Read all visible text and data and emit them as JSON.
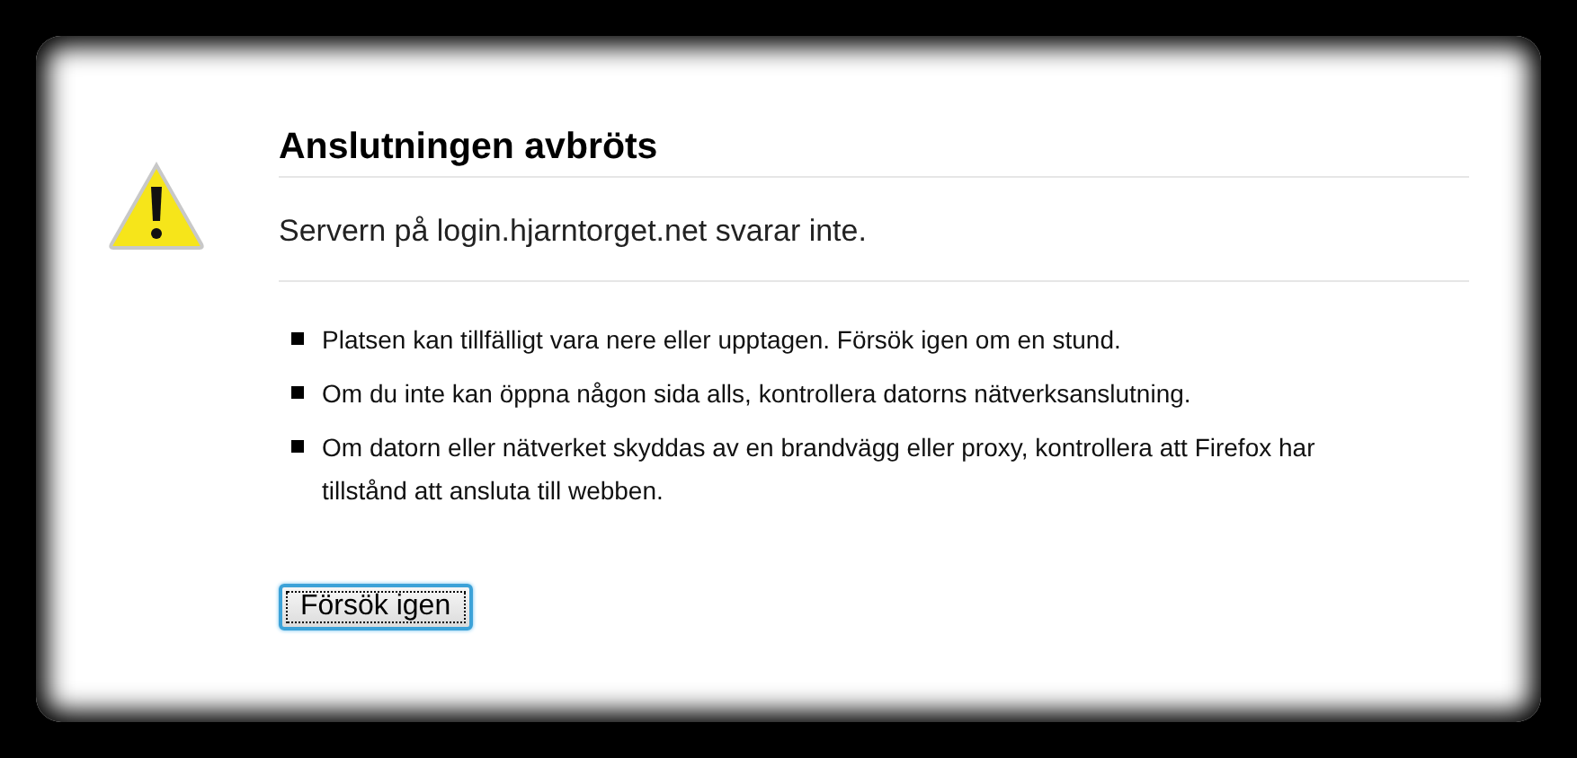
{
  "title": "Anslutningen avbröts",
  "message": "Servern på login.hjarntorget.net svarar inte.",
  "suggestions": [
    "Platsen kan tillfälligt vara nere eller upptagen. Försök igen om en stund.",
    "Om du inte kan öppna någon sida alls, kontrollera datorns nätverksanslutning.",
    "Om datorn eller nätverket skyddas av en brandvägg eller proxy, kontrollera att Firefox har tillstånd att ansluta till webben."
  ],
  "button": {
    "label": "Försök igen",
    "focused": true
  }
}
